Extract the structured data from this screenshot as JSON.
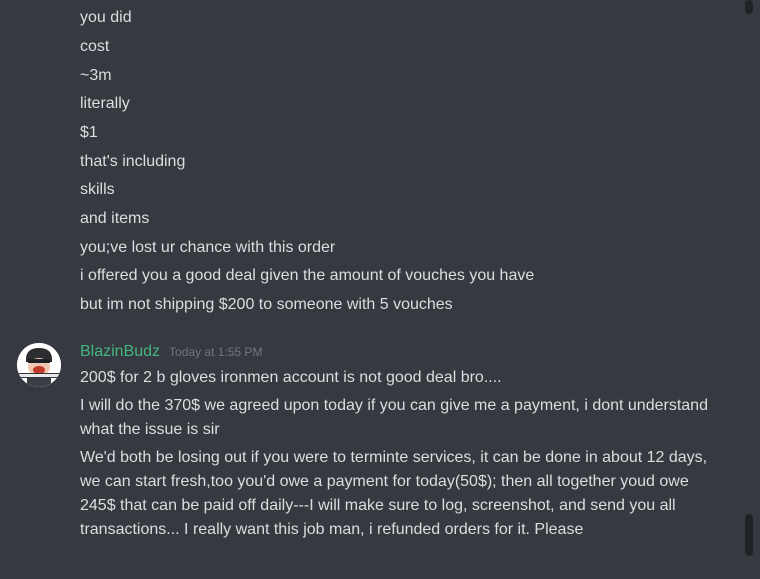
{
  "earlier_messages": [
    "you did",
    "cost",
    "~3m",
    "literally",
    "$1",
    "that's including",
    "skills",
    "and items",
    "you;ve lost ur chance with this order",
    "i offered you a good deal given the amount of vouches you have",
    "but im not shipping $200 to someone with 5 vouches"
  ],
  "message_group": {
    "author": "BlazinBudz",
    "timestamp": "Today at 1:55 PM",
    "author_color": "#43b581",
    "avatar_icon": "cartoon-character-avatar",
    "lines": [
      "200$ for 2 b gloves ironmen account is not good deal bro....",
      "I will do the 370$ we agreed upon today if you can give me a payment, i dont understand what the issue is sir",
      "We'd both be losing out if you were to terminte services, it can be done in about 12 days, we can start fresh,too you'd owe a payment for today(50$); then all together youd owe 245$ that can be paid off daily---I will make sure to log, screenshot, and send you all transactions... I really want this job man, i refunded  orders for it. Please"
    ]
  },
  "colors": {
    "background": "#36393f",
    "text": "#dcddde",
    "timestamp": "#72767d"
  }
}
